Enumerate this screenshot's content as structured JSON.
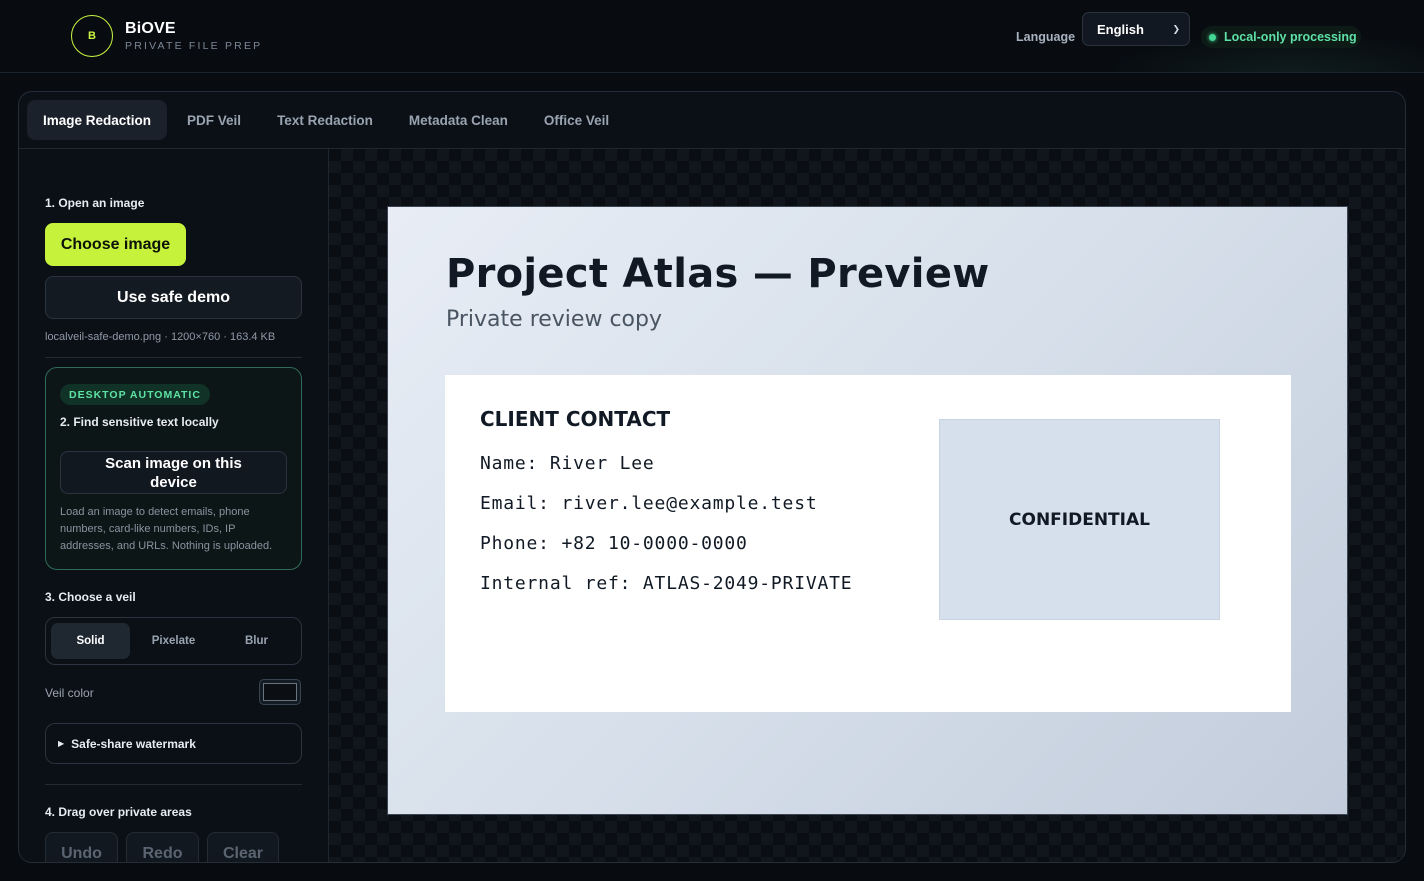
{
  "header": {
    "logo_letter": "B",
    "brand_name": "BiOVE",
    "brand_sub": "PRIVATE FILE PREP",
    "language_label": "Language",
    "language_value": "English",
    "status_text": "Local-only processing"
  },
  "tabs": [
    {
      "label": "Image Redaction",
      "active": true
    },
    {
      "label": "PDF Veil"
    },
    {
      "label": "Text Redaction"
    },
    {
      "label": "Metadata Clean"
    },
    {
      "label": "Office Veil"
    }
  ],
  "sidebar": {
    "step1_title": "1. Open an image",
    "choose_image": "Choose image",
    "use_safe_demo": "Use safe demo",
    "file_info": "localveil-safe-demo.png · 1200×760 · 163.4 KB",
    "auto_badge": "DESKTOP AUTOMATIC",
    "step2_title": "2. Find sensitive text locally",
    "scan_button": "Scan image on this device",
    "scan_desc": "Load an image to detect emails, phone numbers, card-like numbers, IDs, IP addresses, and URLs. Nothing is uploaded.",
    "step3_title": "3. Choose a veil",
    "veil_modes": [
      "Solid",
      "Pixelate",
      "Blur"
    ],
    "veil_color_label": "Veil color",
    "veil_color": "#0b0f14",
    "watermark_label": "Safe-share watermark",
    "step4_title": "4. Drag over private areas",
    "undo": "Undo",
    "redo": "Redo",
    "clear": "Clear"
  },
  "preview": {
    "title": "Project Atlas — Preview",
    "subtitle": "Private review copy",
    "card_heading": "CLIENT CONTACT",
    "lines": [
      "Name: River Lee",
      "Email: river.lee@example.test",
      "Phone: +82 10-0000-0000",
      "Internal ref: ATLAS-2049-PRIVATE"
    ],
    "confidential": "CONFIDENTIAL"
  },
  "colors": {
    "accent": "#c6f23c",
    "status": "#44d695"
  }
}
